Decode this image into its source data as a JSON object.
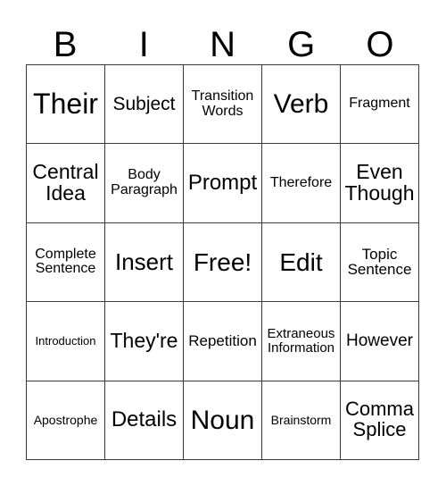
{
  "card": {
    "header_letters": [
      "B",
      "I",
      "N",
      "G",
      "O"
    ],
    "border_color": "#3a3a3a",
    "background_color": "#ffffff",
    "text_color": "#000000",
    "columns": 5,
    "rows": 5,
    "rows_data": [
      [
        {
          "text": "Their",
          "size": "fs-32",
          "free": false
        },
        {
          "text": "Subject",
          "size": "fs-21",
          "free": false
        },
        {
          "text": "Transition\nWords",
          "size": "fs-16",
          "free": false
        },
        {
          "text": "Verb",
          "size": "fs-30",
          "free": false
        },
        {
          "text": "Fragment",
          "size": "fs-16",
          "free": false
        }
      ],
      [
        {
          "text": "Central\nIdea",
          "size": "fs-23",
          "free": false
        },
        {
          "text": "Body\nParagraph",
          "size": "fs-16",
          "free": false
        },
        {
          "text": "Prompt",
          "size": "fs-24",
          "free": false
        },
        {
          "text": "Therefore",
          "size": "fs-16",
          "free": false
        },
        {
          "text": "Even\nThough",
          "size": "fs-23",
          "free": false
        }
      ],
      [
        {
          "text": "Complete\nSentence",
          "size": "fs-16",
          "free": false
        },
        {
          "text": "Insert",
          "size": "fs-26",
          "free": false
        },
        {
          "text": "Free!",
          "size": "fs-28",
          "free": true
        },
        {
          "text": "Edit",
          "size": "fs-28",
          "free": false
        },
        {
          "text": "Topic\nSentence",
          "size": "fs-17",
          "free": false
        }
      ],
      [
        {
          "text": "Introduction",
          "size": "fs-13",
          "free": false
        },
        {
          "text": "They're",
          "size": "fs-23",
          "free": false
        },
        {
          "text": "Repetition",
          "size": "fs-17",
          "free": false
        },
        {
          "text": "Extraneous\nInformation",
          "size": "fs-15",
          "free": false
        },
        {
          "text": "However",
          "size": "fs-19",
          "free": false
        }
      ],
      [
        {
          "text": "Apostrophe",
          "size": "fs-14",
          "free": false
        },
        {
          "text": "Details",
          "size": "fs-24",
          "free": false
        },
        {
          "text": "Noun",
          "size": "fs-30",
          "free": false
        },
        {
          "text": "Brainstorm",
          "size": "fs-14",
          "free": false
        },
        {
          "text": "Comma\nSplice",
          "size": "fs-22",
          "free": false
        }
      ]
    ]
  }
}
